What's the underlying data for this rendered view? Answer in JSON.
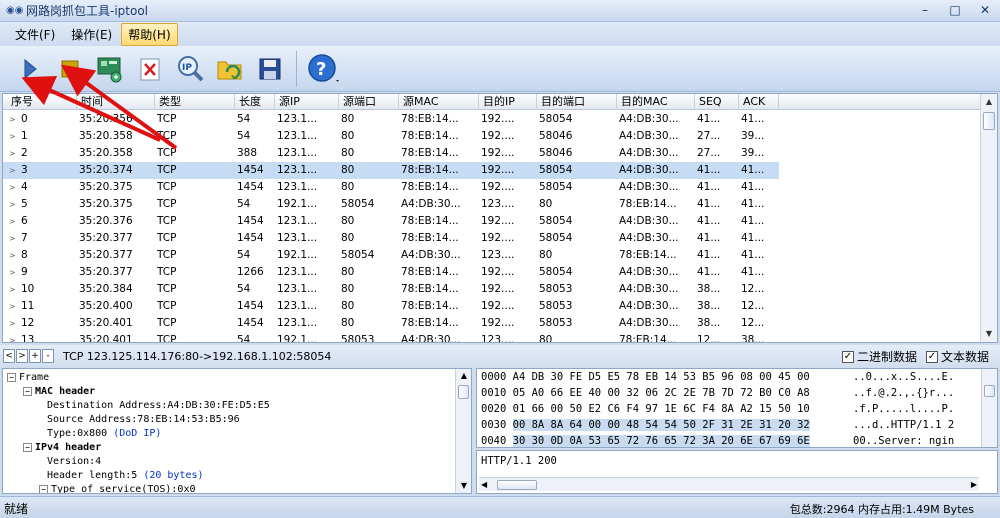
{
  "window": {
    "title": "网路岗抓包工具-iptool",
    "min": "–",
    "max": "□",
    "close": "✕"
  },
  "menu": [
    {
      "label": "文件(F)",
      "active": false
    },
    {
      "label": "操作(E)",
      "active": false
    },
    {
      "label": "帮助(H)",
      "active": true
    }
  ],
  "toolbar": {
    "items": [
      "start-capture",
      "stop-capture",
      "network-adapter",
      "clear-list",
      "search-ip",
      "open-file",
      "save-file",
      "help"
    ]
  },
  "packet_list": {
    "columns": [
      "序号",
      "时间",
      "类型",
      "长度",
      "源IP",
      "源端口",
      "源MAC",
      "目的IP",
      "目的端口",
      "目的MAC",
      "SEQ",
      "ACK"
    ],
    "rows": [
      [
        "0",
        "35:20.356",
        "TCP",
        "54",
        "123.1...",
        "80",
        "78:EB:14...",
        "192....",
        "58054",
        "A4:DB:30...",
        "41...",
        "41..."
      ],
      [
        "1",
        "35:20.358",
        "TCP",
        "54",
        "123.1...",
        "80",
        "78:EB:14...",
        "192....",
        "58046",
        "A4:DB:30...",
        "27...",
        "39..."
      ],
      [
        "2",
        "35:20.358",
        "TCP",
        "388",
        "123.1...",
        "80",
        "78:EB:14...",
        "192....",
        "58046",
        "A4:DB:30...",
        "27...",
        "39..."
      ],
      [
        "3",
        "35:20.374",
        "TCP",
        "1454",
        "123.1...",
        "80",
        "78:EB:14...",
        "192....",
        "58054",
        "A4:DB:30...",
        "41...",
        "41..."
      ],
      [
        "4",
        "35:20.375",
        "TCP",
        "1454",
        "123.1...",
        "80",
        "78:EB:14...",
        "192....",
        "58054",
        "A4:DB:30...",
        "41...",
        "41..."
      ],
      [
        "5",
        "35:20.375",
        "TCP",
        "54",
        "192.1...",
        "58054",
        "A4:DB:30...",
        "123....",
        "80",
        "78:EB:14...",
        "41...",
        "41..."
      ],
      [
        "6",
        "35:20.376",
        "TCP",
        "1454",
        "123.1...",
        "80",
        "78:EB:14...",
        "192....",
        "58054",
        "A4:DB:30...",
        "41...",
        "41..."
      ],
      [
        "7",
        "35:20.377",
        "TCP",
        "1454",
        "123.1...",
        "80",
        "78:EB:14...",
        "192....",
        "58054",
        "A4:DB:30...",
        "41...",
        "41..."
      ],
      [
        "8",
        "35:20.377",
        "TCP",
        "54",
        "192.1...",
        "58054",
        "A4:DB:30...",
        "123....",
        "80",
        "78:EB:14...",
        "41...",
        "41..."
      ],
      [
        "9",
        "35:20.377",
        "TCP",
        "1266",
        "123.1...",
        "80",
        "78:EB:14...",
        "192....",
        "58054",
        "A4:DB:30...",
        "41...",
        "41..."
      ],
      [
        "10",
        "35:20.384",
        "TCP",
        "54",
        "123.1...",
        "80",
        "78:EB:14...",
        "192....",
        "58053",
        "A4:DB:30...",
        "38...",
        "12..."
      ],
      [
        "11",
        "35:20.400",
        "TCP",
        "1454",
        "123.1...",
        "80",
        "78:EB:14...",
        "192....",
        "58053",
        "A4:DB:30...",
        "38...",
        "12..."
      ],
      [
        "12",
        "35:20.401",
        "TCP",
        "1454",
        "123.1...",
        "80",
        "78:EB:14...",
        "192....",
        "58053",
        "A4:DB:30...",
        "38...",
        "12..."
      ],
      [
        "13",
        "35:20.401",
        "TCP",
        "54",
        "192.1...",
        "58053",
        "A4:DB:30...",
        "123....",
        "80",
        "78:EB:14...",
        "12...",
        "38..."
      ]
    ],
    "selected_index": 3
  },
  "detail_bar": {
    "nav": [
      "<",
      ">",
      "+",
      "-"
    ],
    "summary": "TCP 123.125.114.176:80->192.168.1.102:58054",
    "binary_label": "二进制数据",
    "text_label": "文本数据",
    "check_mark": "✓"
  },
  "tree": [
    {
      "toggle": "−",
      "text": "Frame",
      "note": "",
      "bold": false
    },
    {
      "toggle": "−",
      "text": "MAC header",
      "note": "",
      "bold": true
    },
    {
      "toggle": "",
      "text": "Destination Address:A4:DB:30:FE:D5:E5",
      "note": "",
      "bold": false
    },
    {
      "toggle": "",
      "text": "Source Address:78:EB:14:53:B5:96",
      "note": "",
      "bold": false
    },
    {
      "toggle": "",
      "text": "Type:0x800",
      "note": "(DoD IP)",
      "bold": false
    },
    {
      "toggle": "−",
      "text": "IPv4 header",
      "note": "",
      "bold": true
    },
    {
      "toggle": "",
      "text": "Version:4",
      "note": "",
      "bold": false
    },
    {
      "toggle": "",
      "text": "Header length:5",
      "note": "(20 bytes)",
      "bold": false
    },
    {
      "toggle": "−",
      "text": "Type of service(TOS):0x0",
      "note": "",
      "bold": false
    }
  ],
  "hex": [
    {
      "off": "0000",
      "bytes": "A4 DB 30 FE D5 E5 78 EB 14 53 B5 96 08 00 45 00",
      "ascii": "..0...x..S....E."
    },
    {
      "off": "0010",
      "bytes": "05 A0 66 EE 40 00 32 06 2C 2E 7B 7D 72 B0 C0 A8",
      "ascii": "..f.@.2.,.{}r..."
    },
    {
      "off": "0020",
      "bytes": "01 66 00 50 E2 C6 F4 97 1E 6C F4 8A A2 15 50 10",
      "ascii": ".f.P.....l....P."
    },
    {
      "off": "0030",
      "bytes": "00 8A 8A 64 00 00 48 54 54 50 2F 31 2E 31 20 32",
      "ascii": "...d..HTTP/1.1 2"
    },
    {
      "off": "0040",
      "bytes": "30 30 0D 0A 53 65 72 76 65 72 3A 20 6E 67 69 6E",
      "ascii": "00..Server: ngin"
    }
  ],
  "text_data": "HTTP/1.1 200",
  "status": {
    "left": "就绪",
    "right": "包总数:2964  内存占用:1.49M Bytes"
  }
}
